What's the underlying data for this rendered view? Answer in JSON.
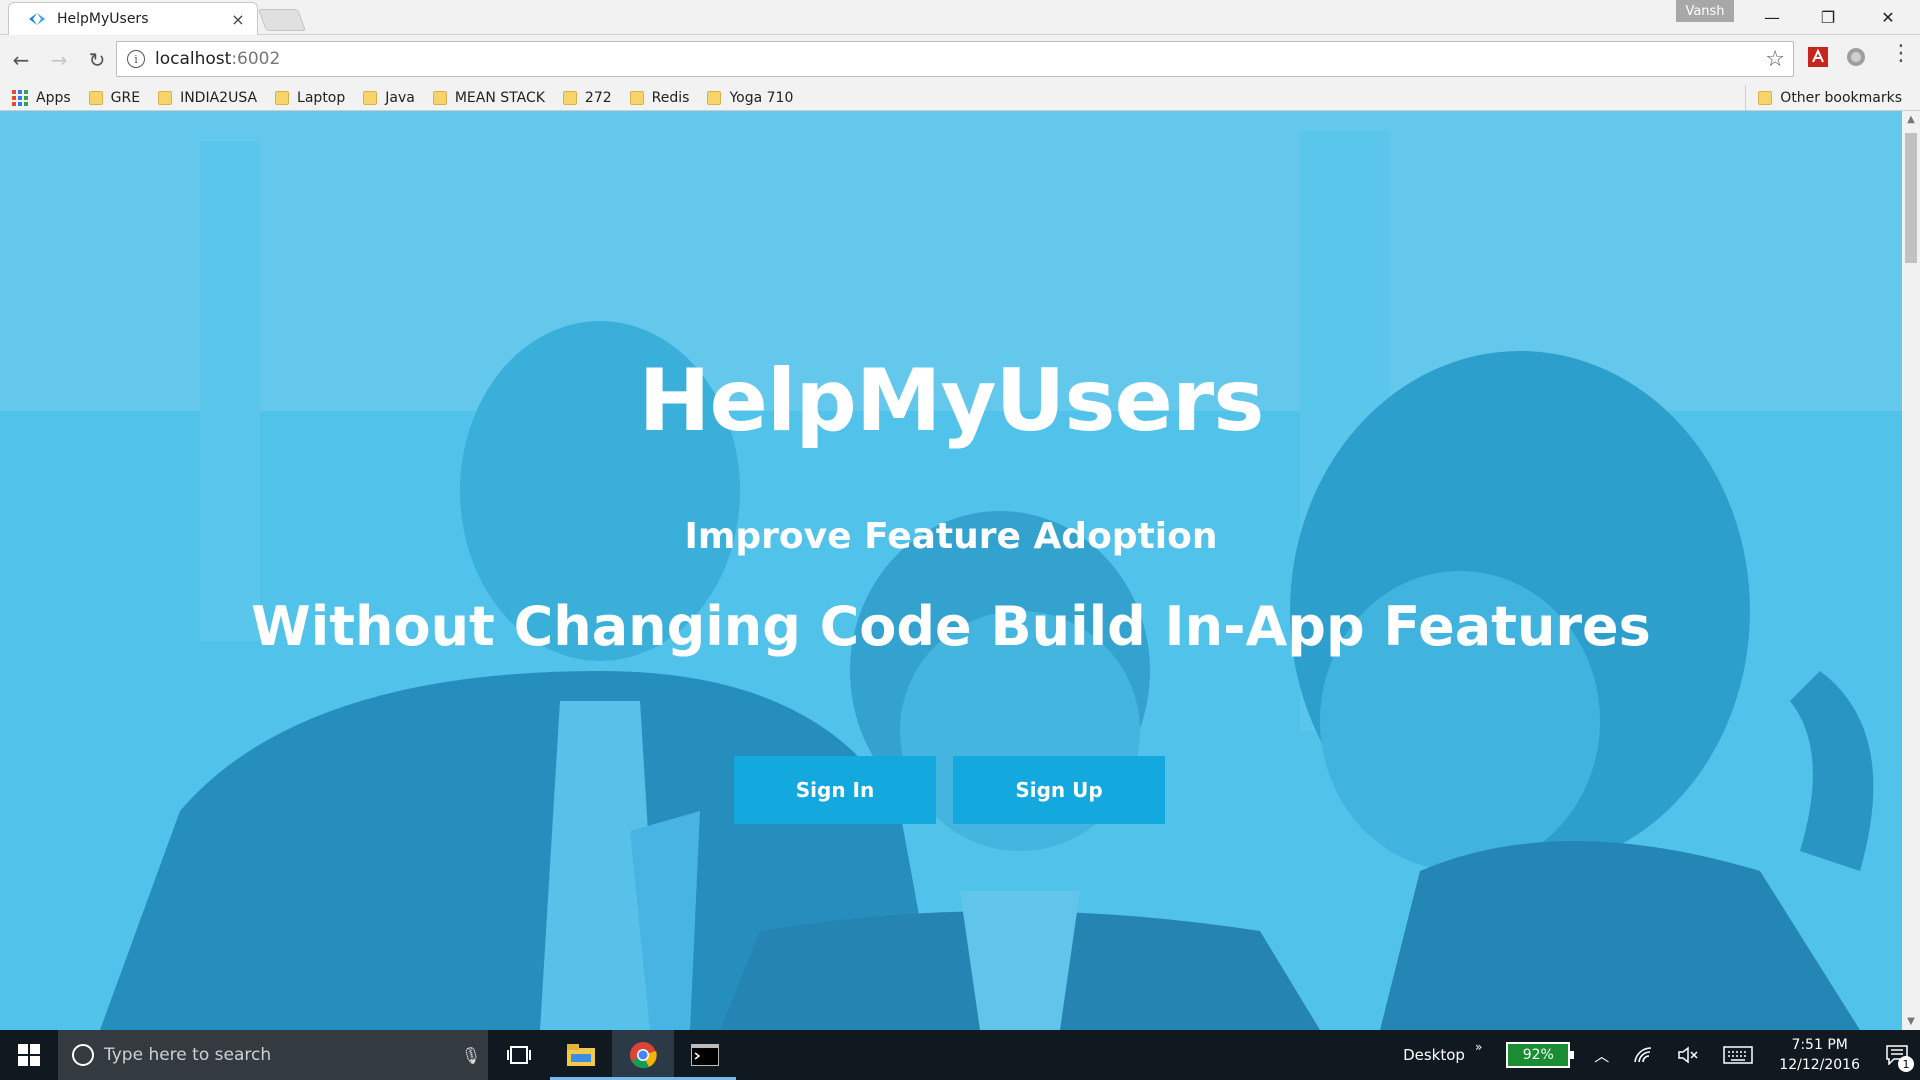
{
  "browser": {
    "tab": {
      "title": "HelpMyUsers",
      "close": "×"
    },
    "profile_name": "Vansh",
    "window_controls": {
      "minimize": "—",
      "restore": "❐",
      "close": "✕"
    },
    "nav": {
      "back": "←",
      "forward": "→",
      "reload": "↻"
    },
    "address": {
      "host": "localhost",
      "port": ":6002",
      "info": "i",
      "star": "☆"
    },
    "menu": "⋮"
  },
  "bookmarks": {
    "apps_label": "Apps",
    "items": [
      {
        "label": "GRE"
      },
      {
        "label": "INDIA2USA"
      },
      {
        "label": "Laptop"
      },
      {
        "label": "Java"
      },
      {
        "label": "MEAN STACK"
      },
      {
        "label": "272"
      },
      {
        "label": "Redis"
      },
      {
        "label": "Yoga 710"
      }
    ],
    "other_label": "Other bookmarks"
  },
  "hero": {
    "brand": "HelpMyUsers",
    "tagline": "Improve Feature Adoption",
    "subline": "Without Changing Code Build In-App Features",
    "signin_label": "Sign In",
    "signup_label": "Sign Up",
    "overlay_color": "#2bb5e6",
    "button_color": "#13a9de"
  },
  "taskbar": {
    "search_placeholder": "Type here to search",
    "desktop_label": "Desktop",
    "battery_percent": "92%",
    "time": "7:51 PM",
    "date": "12/12/2016",
    "notification_count": "1"
  }
}
